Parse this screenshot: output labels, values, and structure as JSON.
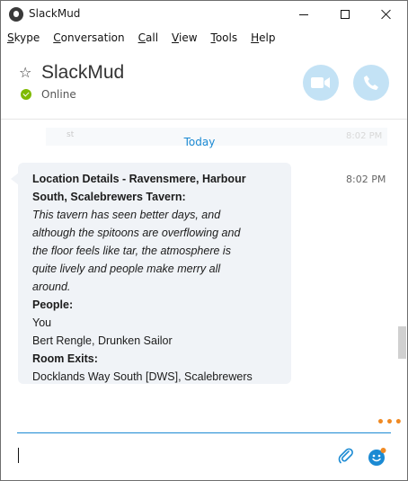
{
  "window": {
    "title": "SlackMud"
  },
  "menu": [
    {
      "pre": "",
      "acc": "S",
      "post": "kype"
    },
    {
      "pre": "",
      "acc": "C",
      "post": "onversation"
    },
    {
      "pre": "",
      "acc": "C",
      "post": "all"
    },
    {
      "pre": "",
      "acc": "V",
      "post": "iew"
    },
    {
      "pre": "",
      "acc": "T",
      "post": "ools"
    },
    {
      "pre": "",
      "acc": "H",
      "post": "elp"
    }
  ],
  "header": {
    "contact_name": "SlackMud",
    "status": "Online"
  },
  "chat": {
    "ghost_text": "st",
    "ghost_time": "8:02 PM",
    "date_divider": "Today",
    "message": {
      "time": "8:02 PM",
      "lines": [
        {
          "text": "Location Details - Ravensmere, Harbour",
          "style": "bold"
        },
        {
          "text": "South, Scalebrewers Tavern:",
          "style": "bold"
        },
        {
          "text": "This tavern has seen better days, and",
          "style": "italic"
        },
        {
          "text": "although the spitoons are overflowing and",
          "style": "italic"
        },
        {
          "text": "the floor feels like tar, the atmosphere is",
          "style": "italic"
        },
        {
          "text": "quite lively and people make merry all",
          "style": "italic"
        },
        {
          "text": "around.",
          "style": "italic"
        },
        {
          "text": "People:",
          "style": "bold"
        },
        {
          "text": "You",
          "style": "normal"
        },
        {
          "text": "Bert Rengle, Drunken Sailor",
          "style": "normal"
        },
        {
          "text": "Room Exits:",
          "style": "bold"
        },
        {
          "text": "Docklands Way South [DWS], Scalebrewers",
          "style": "normal"
        }
      ]
    }
  },
  "compose": {
    "value": "",
    "more_label": "•••"
  },
  "colors": {
    "accent": "#1b8ad3",
    "online": "#7fba00",
    "call_button": "#c3e2f5",
    "bubble": "#f0f3f7",
    "more_dots": "#f08a24"
  }
}
